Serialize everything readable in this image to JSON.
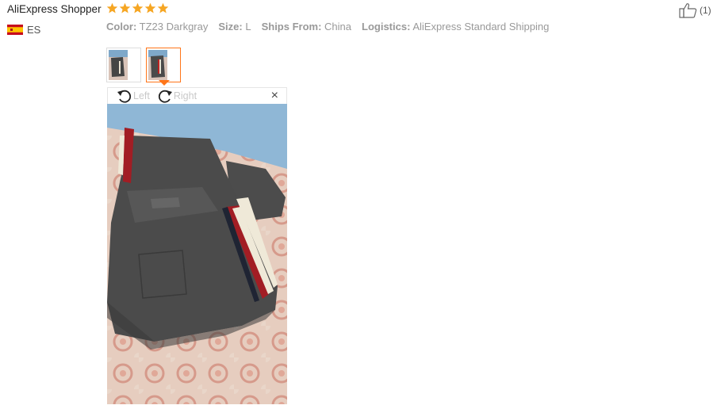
{
  "review": {
    "reviewer_name": "AliExpress Shopper",
    "rating": 5,
    "country": "ES",
    "attributes": [
      {
        "key": "Color:",
        "value": "TZ23 Darkgray"
      },
      {
        "key": "Size:",
        "value": "L"
      },
      {
        "key": "Ships From:",
        "value": "China"
      },
      {
        "key": "Logistics:",
        "value": "AliExpress Standard Shipping"
      }
    ],
    "helpful_count": "(1)"
  },
  "viewer": {
    "rotate_left_label": "Left",
    "rotate_right_label": "Right",
    "close_glyph": "×"
  },
  "icons": {
    "star": "star-icon",
    "flag": "spain-flag-icon",
    "helpful": "thumbs-up-icon",
    "rotate_left": "rotate-left-icon",
    "rotate_right": "rotate-right-icon",
    "close": "close-icon"
  },
  "colors": {
    "star": "#f6a623",
    "accent": "#ff7519",
    "muted_text": "#999999"
  }
}
